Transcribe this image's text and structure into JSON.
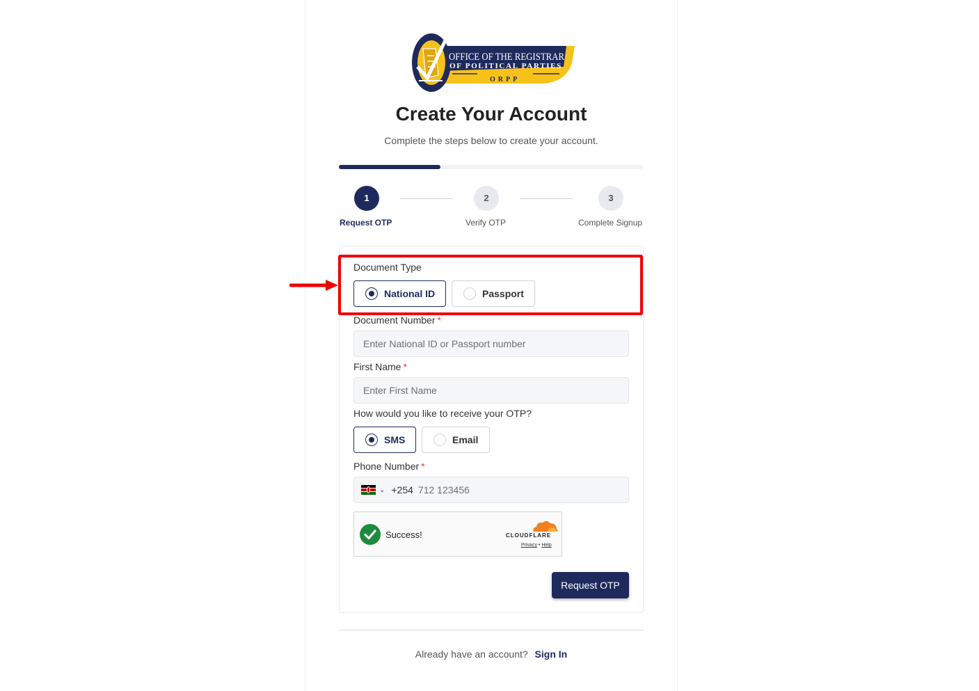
{
  "logo": {
    "line1": "OFFICE OF THE REGISTRAR",
    "line2": "OF POLITICAL PARTIES",
    "line3": "ORPP"
  },
  "header": {
    "title": "Create Your Account",
    "subtitle": "Complete the steps below to create your account."
  },
  "progress": {
    "fraction": 0.333
  },
  "steps": [
    {
      "number": "1",
      "label": "Request OTP",
      "state": "active"
    },
    {
      "number": "2",
      "label": "Verify OTP",
      "state": "inactive"
    },
    {
      "number": "3",
      "label": "Complete Signup",
      "state": "inactive"
    }
  ],
  "form": {
    "document_type": {
      "label": "Document Type",
      "options": [
        "National ID",
        "Passport"
      ],
      "selected": "National ID"
    },
    "document_number": {
      "label": "Document Number",
      "required_mark": "*",
      "placeholder": "Enter National ID or Passport number",
      "value": ""
    },
    "first_name": {
      "label": "First Name",
      "required_mark": "*",
      "placeholder": "Enter First Name",
      "value": ""
    },
    "otp_method": {
      "label": "How would you like to receive your OTP?",
      "options": [
        "SMS",
        "Email"
      ],
      "selected": "SMS"
    },
    "phone": {
      "label": "Phone Number",
      "required_mark": "*",
      "country_icon": "kenya-flag-icon",
      "dial_code": "+254",
      "placeholder": "712 123456",
      "value": ""
    },
    "captcha": {
      "status": "Success!",
      "brand": "CLOUDFLARE",
      "privacy": "Privacy",
      "separator": "•",
      "help": "Help"
    },
    "submit_label": "Request OTP"
  },
  "footer": {
    "prompt": "Already have an account?",
    "link": "Sign In"
  },
  "colors": {
    "primary": "#1f2a5c",
    "highlight": "#ee0000",
    "success": "#1e8a3e",
    "required": "#e53935"
  }
}
